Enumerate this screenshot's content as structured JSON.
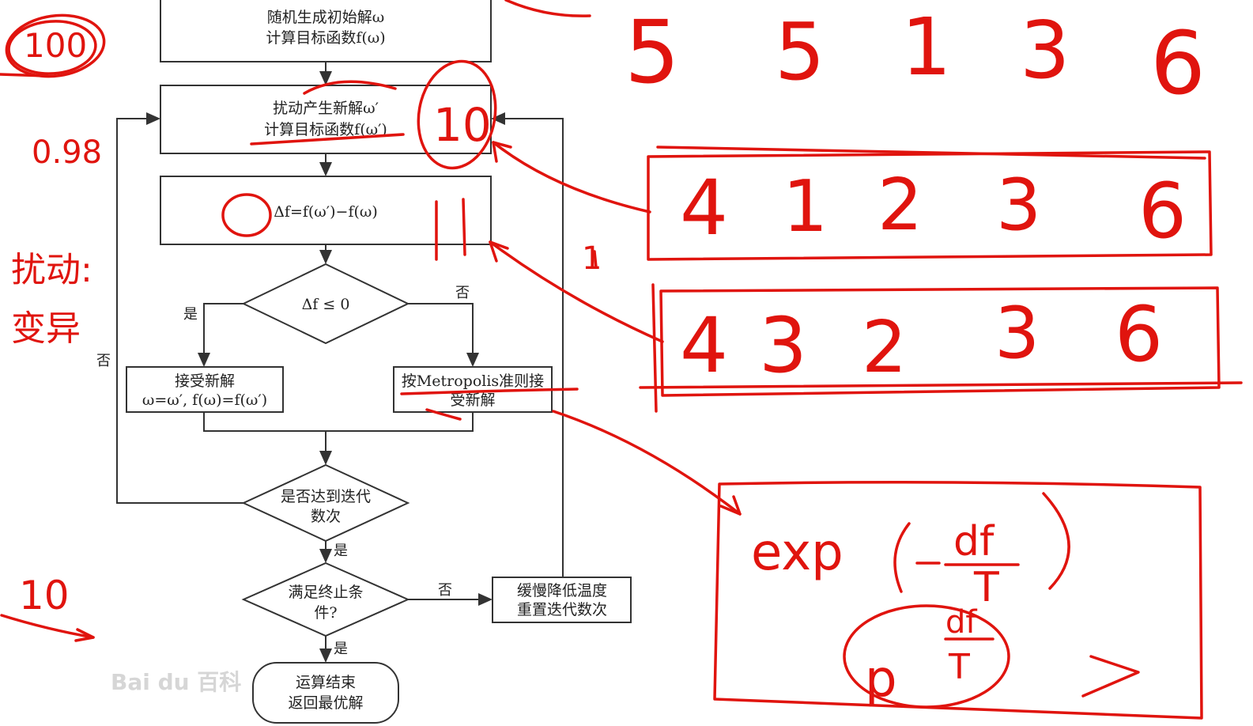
{
  "flowchart": {
    "box_init": [
      "随机生成初始解ω",
      "计算目标函数f(ω)"
    ],
    "box_perturb": [
      "扰动产生新解ω′",
      "计算目标函数f(ω′)"
    ],
    "box_delta": "Δf=f(ω′)−f(ω)",
    "diamond_delta": "Δf ≤ 0",
    "label_yes_1": "是",
    "label_no_1": "否",
    "box_accept": [
      "接受新解",
      "ω=ω′, f(ω)=f(ω′)"
    ],
    "box_metropolis": [
      "按Metropolis准则接",
      "受新解"
    ],
    "diamond_iter": [
      "是否达到迭代",
      "数次"
    ],
    "label_no_left": "否",
    "label_yes_2": "是",
    "diamond_stop": [
      "满足终止条",
      "件?"
    ],
    "label_no_2": "否",
    "box_cool": [
      "缓慢降低温度",
      "重置迭代数次"
    ],
    "label_yes_3": "是",
    "end_terminal": [
      "运算结束",
      "返回最优解"
    ]
  },
  "watermark": "Bai du 百科",
  "annotations": {
    "left_top": "100",
    "left_rate": "0.98",
    "left_words_1": "扰动:",
    "left_words_2": "变异",
    "left_bottom": "10",
    "circle_10": "10",
    "mark_11": "11",
    "mark_1": "1",
    "top_row": [
      "5",
      "5",
      "1",
      "3",
      "6"
    ],
    "row_1": [
      "4",
      "1",
      "2",
      "3",
      "6"
    ],
    "row_2": [
      "4",
      "3",
      "2",
      "3",
      "6"
    ],
    "formula_exp": "exp",
    "formula_num": "df",
    "formula_den": "T",
    "formula_sub_num": "df",
    "formula_sub_den": "T",
    "formula_p": "p",
    "formula_gt": ">"
  },
  "colors": {
    "ink": "#222222",
    "annotation": "#e0140e",
    "watermark": "#d6d6d6"
  }
}
